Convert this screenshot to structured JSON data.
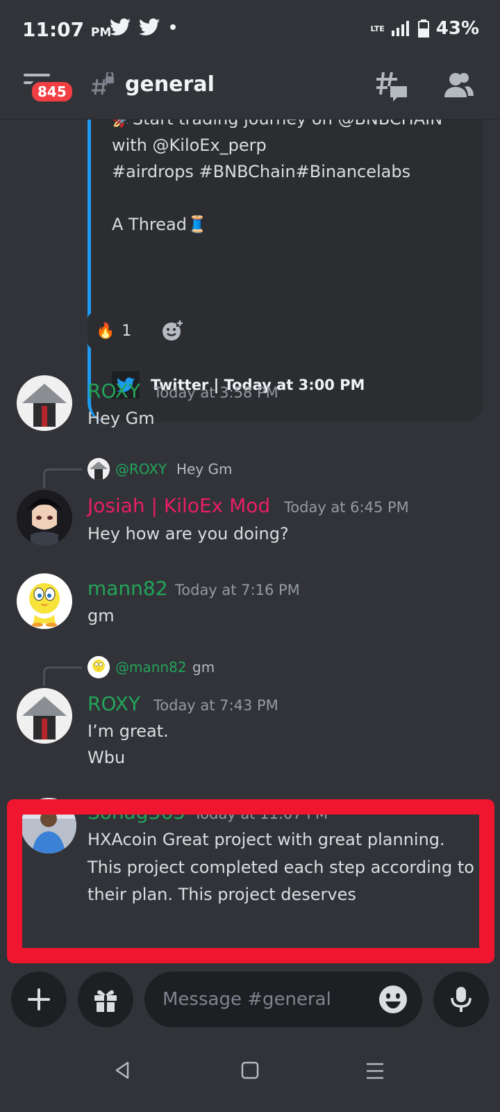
{
  "status_bar": {
    "time": "11:07",
    "ampm": "PM",
    "network": "LTE",
    "battery": "43%"
  },
  "header": {
    "badge_count": "845",
    "channel_name": "general"
  },
  "embed": {
    "text": "🚀Start trading journey on @BNBCHAIN\nwith @KiloEx_perp\n#airdrops #BNBChain#Binancelabs\n\nA Thread🧵",
    "footer": "Twitter | Today at 3:00 PM"
  },
  "reaction": {
    "emoji": "🔥",
    "count": "1"
  },
  "messages": [
    {
      "username": "ROXY",
      "username_color": "#23a55a",
      "timestamp": "Today at 3:58 PM",
      "lines": [
        "Hey Gm"
      ]
    },
    {
      "reply_to": {
        "name": "@ROXY",
        "text": "Hey Gm"
      },
      "username": "Josiah | KiloEx Mod",
      "username_color": "#e91e63",
      "timestamp": "Today at 6:45 PM",
      "lines": [
        "Hey how are you doing?"
      ]
    },
    {
      "username": "mann82",
      "username_color": "#23a55a",
      "timestamp": "Today at 7:16 PM",
      "lines": [
        "gm"
      ]
    },
    {
      "reply_to": {
        "name": "@mann82",
        "text": "gm"
      },
      "username": "ROXY",
      "username_color": "#23a55a",
      "timestamp": "Today at 7:43 PM",
      "lines": [
        "I’m great.",
        "Wbu"
      ]
    },
    {
      "username": "Sohag365",
      "username_color": "#23a55a",
      "timestamp": "Today at 11:07 PM",
      "lines": [
        "HXAcoin Great project with great planning.",
        "This project completed each step according to",
        "their plan. This project deserves"
      ]
    }
  ],
  "input": {
    "placeholder": "Message #general"
  },
  "colors": {
    "background": "#313338",
    "highlight_border": "#f0162f",
    "twitter_blue": "#1d9bf0"
  }
}
